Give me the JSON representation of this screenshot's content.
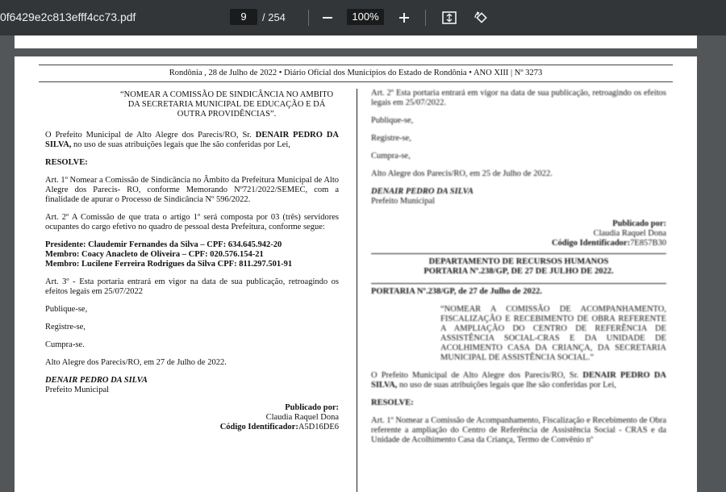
{
  "toolbar": {
    "filename": "0f6429e2c813efff4cc73.pdf",
    "current_page": "9",
    "total_pages": "/ 254",
    "zoom": "100%"
  },
  "page": {
    "header": "Rondônia , 28 de Julho de 2022   •   Diário Oficial dos Municípios do Estado de Rondônia   •   ANO XIII | Nº 3273",
    "left": {
      "quote": "“NOMEAR A COMISSÃO DE SINDICÂNCIA NO AMBITO DA SECRETARIA MUNICIPAL DE EDUCAÇÃO E DÁ OUTRA PROVIDÊNCIAS”.",
      "intro_a": "O Prefeito Municipal de Alto Alegre dos Parecis/RO, Sr. ",
      "intro_name": "DENAIR PEDRO DA SILVA,",
      "intro_b": " no uso de suas atribuições legais que lhe são conferidas por Lei,",
      "resolve": "RESOLVE:",
      "art1": "Art. 1º Nomear a Comissão de Sindicância no Âmbito da Prefeitura Municipal de Alto Alegre dos Parecis- RO, conforme Memorando Nº721/2022/SEMEC, com a finalidade de apurar o Processo de Sindicância Nº 596/2022.",
      "art2": "Art. 2º A Comissão de que trata o artigo 1º será composta por 03 (três) servidores ocupantes do cargo efetivo no quadro de pessoal desta Prefeitura, conforme segue:",
      "member1": "Presidente: Claudemir Fernandes da Silva – CPF: 634.645.942-20",
      "member2": "Membro: Coacy Anacleto de Oliveira – CPF: 020.576.154-21",
      "member3": "Membro: Lucilene Ferreira Rodrigues da Silva CPF: 811.297.501-91",
      "art3": "Art. 3º - Esta portaria entrará em vigor na data de sua publicação, retroagindo os efeitos legais em 25/07/2022",
      "publique": "Publique-se,",
      "registre": "Registre-se,",
      "cumpra": "Cumpra-se.",
      "date": "Alto Alegre dos Parecis/RO, em 27 de Julho de 2022.",
      "signer": "DENAIR PEDRO DA SILVA",
      "signer_title": "Prefeito Municipal",
      "published_by": "Publicado por:",
      "publisher": "Claudia Raquel Dona",
      "code_label": "Código Identificador:",
      "code": "A5D16DE6"
    },
    "right": {
      "art2": "Art. 2º Esta portaria entrará em vigor na data de sua publicação, retroagindo os efeitos legais em 25/07/2022.",
      "publique": "Publique-se,",
      "registre": "Registre-se,",
      "cumpra": "Cumpra-se,",
      "date": "Alto Alegre dos Parecis/RO, em 25 de Julho de 2022.",
      "signer": "DENAIR PEDRO DA SILVA",
      "signer_title": "Prefeito Municipal",
      "published_by": "Publicado por:",
      "publisher": "Claudia Raquel Dona",
      "code_label": "Código Identificador:",
      "code": "7E857B30",
      "dept_line1": "DEPARTAMENTO DE RECURSOS HUMANOS",
      "dept_line2": "PORTARIA Nº.238/GP, DE 27 DE JULHO DE 2022.",
      "portaria_title": "PORTARIA Nº.238/GP, de 27 de Julho de 2022.",
      "quote": "“NOMEAR A COMISSÃO DE ACOMPANHAMENTO, FISCALIZAÇÃO E RECEBIMENTO DE OBRA REFERENTE A AMPLIAÇÃO DO CENTRO DE REFERÊNCIA DE ASSISTÊNCIA SOCIAL-CRAS E DA UNIDADE DE ACOLHIMENTO CASA DA CRIANÇA, DA SECRETARIA MUNICIPAL DE ASSISTÊNCIA SOCIAL.”",
      "intro_a": "O Prefeito Municipal de Alto Alegre dos Parecis/RO, Sr. ",
      "intro_name": "DENAIR PEDRO DA SILVA,",
      "intro_b": " no uso de suas atribuições legais que lhe são conferidas por Lei,",
      "resolve": "RESOLVE:",
      "art1": "Art. 1º Nomear a Comissão de Acompanhamento, Fiscalização e Recebimento de Obra referente a ampliação do Centro de Referência de Assistência Social - CRAS e da Unidade de Acolhimento Casa da Criança, Termo de Convênio nº"
    }
  }
}
